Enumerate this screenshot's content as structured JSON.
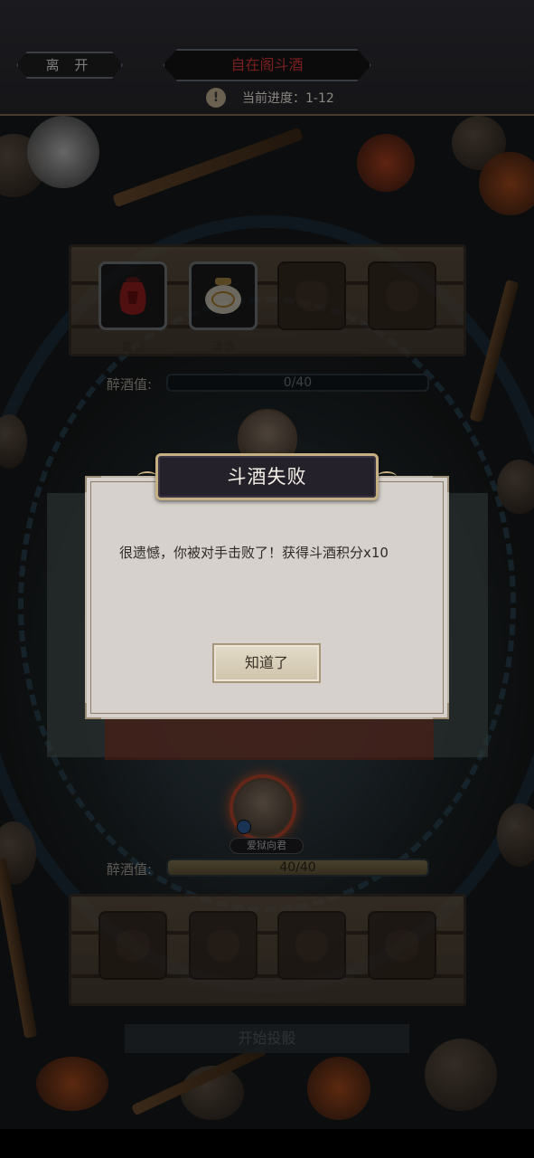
{
  "topbar": {
    "leave_label": "离 开",
    "title": "自在阁斗酒",
    "progress_label": "当前进度：1-12",
    "warn_icon": "!"
  },
  "opponent": {
    "slots": [
      {
        "label": "黄酒",
        "filled": true,
        "icon": "red-wine-jar-icon"
      },
      {
        "label": "清酒",
        "filled": true,
        "icon": "white-wine-jar-icon"
      },
      {
        "label": "",
        "filled": false,
        "icon": "empty-bag-icon"
      },
      {
        "label": "",
        "filled": false,
        "icon": "empty-bag-icon"
      }
    ],
    "drunk_label": "醉酒值:",
    "drunk_text": "0/40",
    "drunk_fraction": 0.0
  },
  "player": {
    "name": "爱狱向君",
    "drunk_label": "醉酒值:",
    "drunk_text": "40/40",
    "drunk_fraction": 1.0,
    "slots": [
      {
        "label": "",
        "filled": false
      },
      {
        "label": "",
        "filled": false
      },
      {
        "label": "",
        "filled": false
      },
      {
        "label": "",
        "filled": false
      }
    ]
  },
  "start_button_label": "开始投骰",
  "dialog": {
    "title": "斗酒失败",
    "message": "很遗憾，你被对手击败了！获得斗酒积分x10",
    "ok_label": "知道了"
  },
  "colors": {
    "title_red": "#7a1f1f",
    "dialog_bg": "#d6d1cc",
    "title_plate": "#24212b",
    "gold_border": "#c6b083"
  }
}
